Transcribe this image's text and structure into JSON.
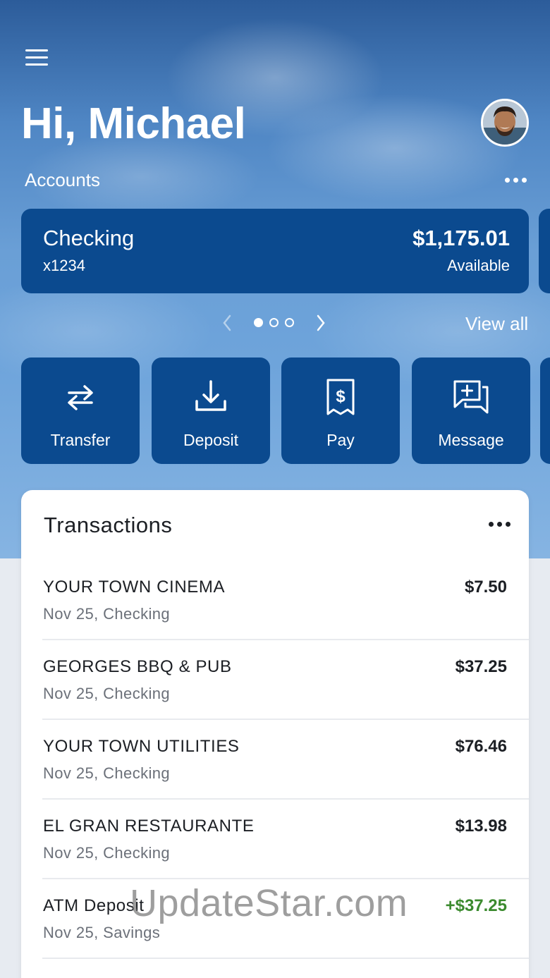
{
  "header": {
    "greeting": "Hi, Michael",
    "accounts_label": "Accounts"
  },
  "account": {
    "name": "Checking",
    "number": "x1234",
    "balance": "$1,175.01",
    "balance_label": "Available"
  },
  "pager": {
    "view_all": "View all",
    "page_count": 3,
    "active_page": 1
  },
  "actions": [
    {
      "label": "Transfer",
      "icon": "transfer-icon"
    },
    {
      "label": "Deposit",
      "icon": "deposit-icon"
    },
    {
      "label": "Pay",
      "icon": "pay-bill-icon"
    },
    {
      "label": "Message",
      "icon": "message-icon"
    }
  ],
  "transactions": {
    "title": "Transactions",
    "items": [
      {
        "name": "YOUR TOWN CINEMA",
        "detail": "Nov 25, Checking",
        "amount": "$7.50",
        "credit": false
      },
      {
        "name": "GEORGES BBQ & PUB",
        "detail": "Nov 25, Checking",
        "amount": "$37.25",
        "credit": false
      },
      {
        "name": "YOUR TOWN UTILITIES",
        "detail": "Nov 25, Checking",
        "amount": "$76.46",
        "credit": false
      },
      {
        "name": "EL GRAN RESTAURANTE",
        "detail": "Nov 25, Checking",
        "amount": "$13.98",
        "credit": false
      },
      {
        "name": "ATM Deposit",
        "detail": "Nov 25, Savings",
        "amount": "+$37.25",
        "credit": true
      }
    ]
  },
  "watermark": "UpdateStar.com",
  "colors": {
    "brand_navy": "#0b4a8f",
    "credit_green": "#3b8a2e",
    "sky_blue": "#6ea4db"
  }
}
